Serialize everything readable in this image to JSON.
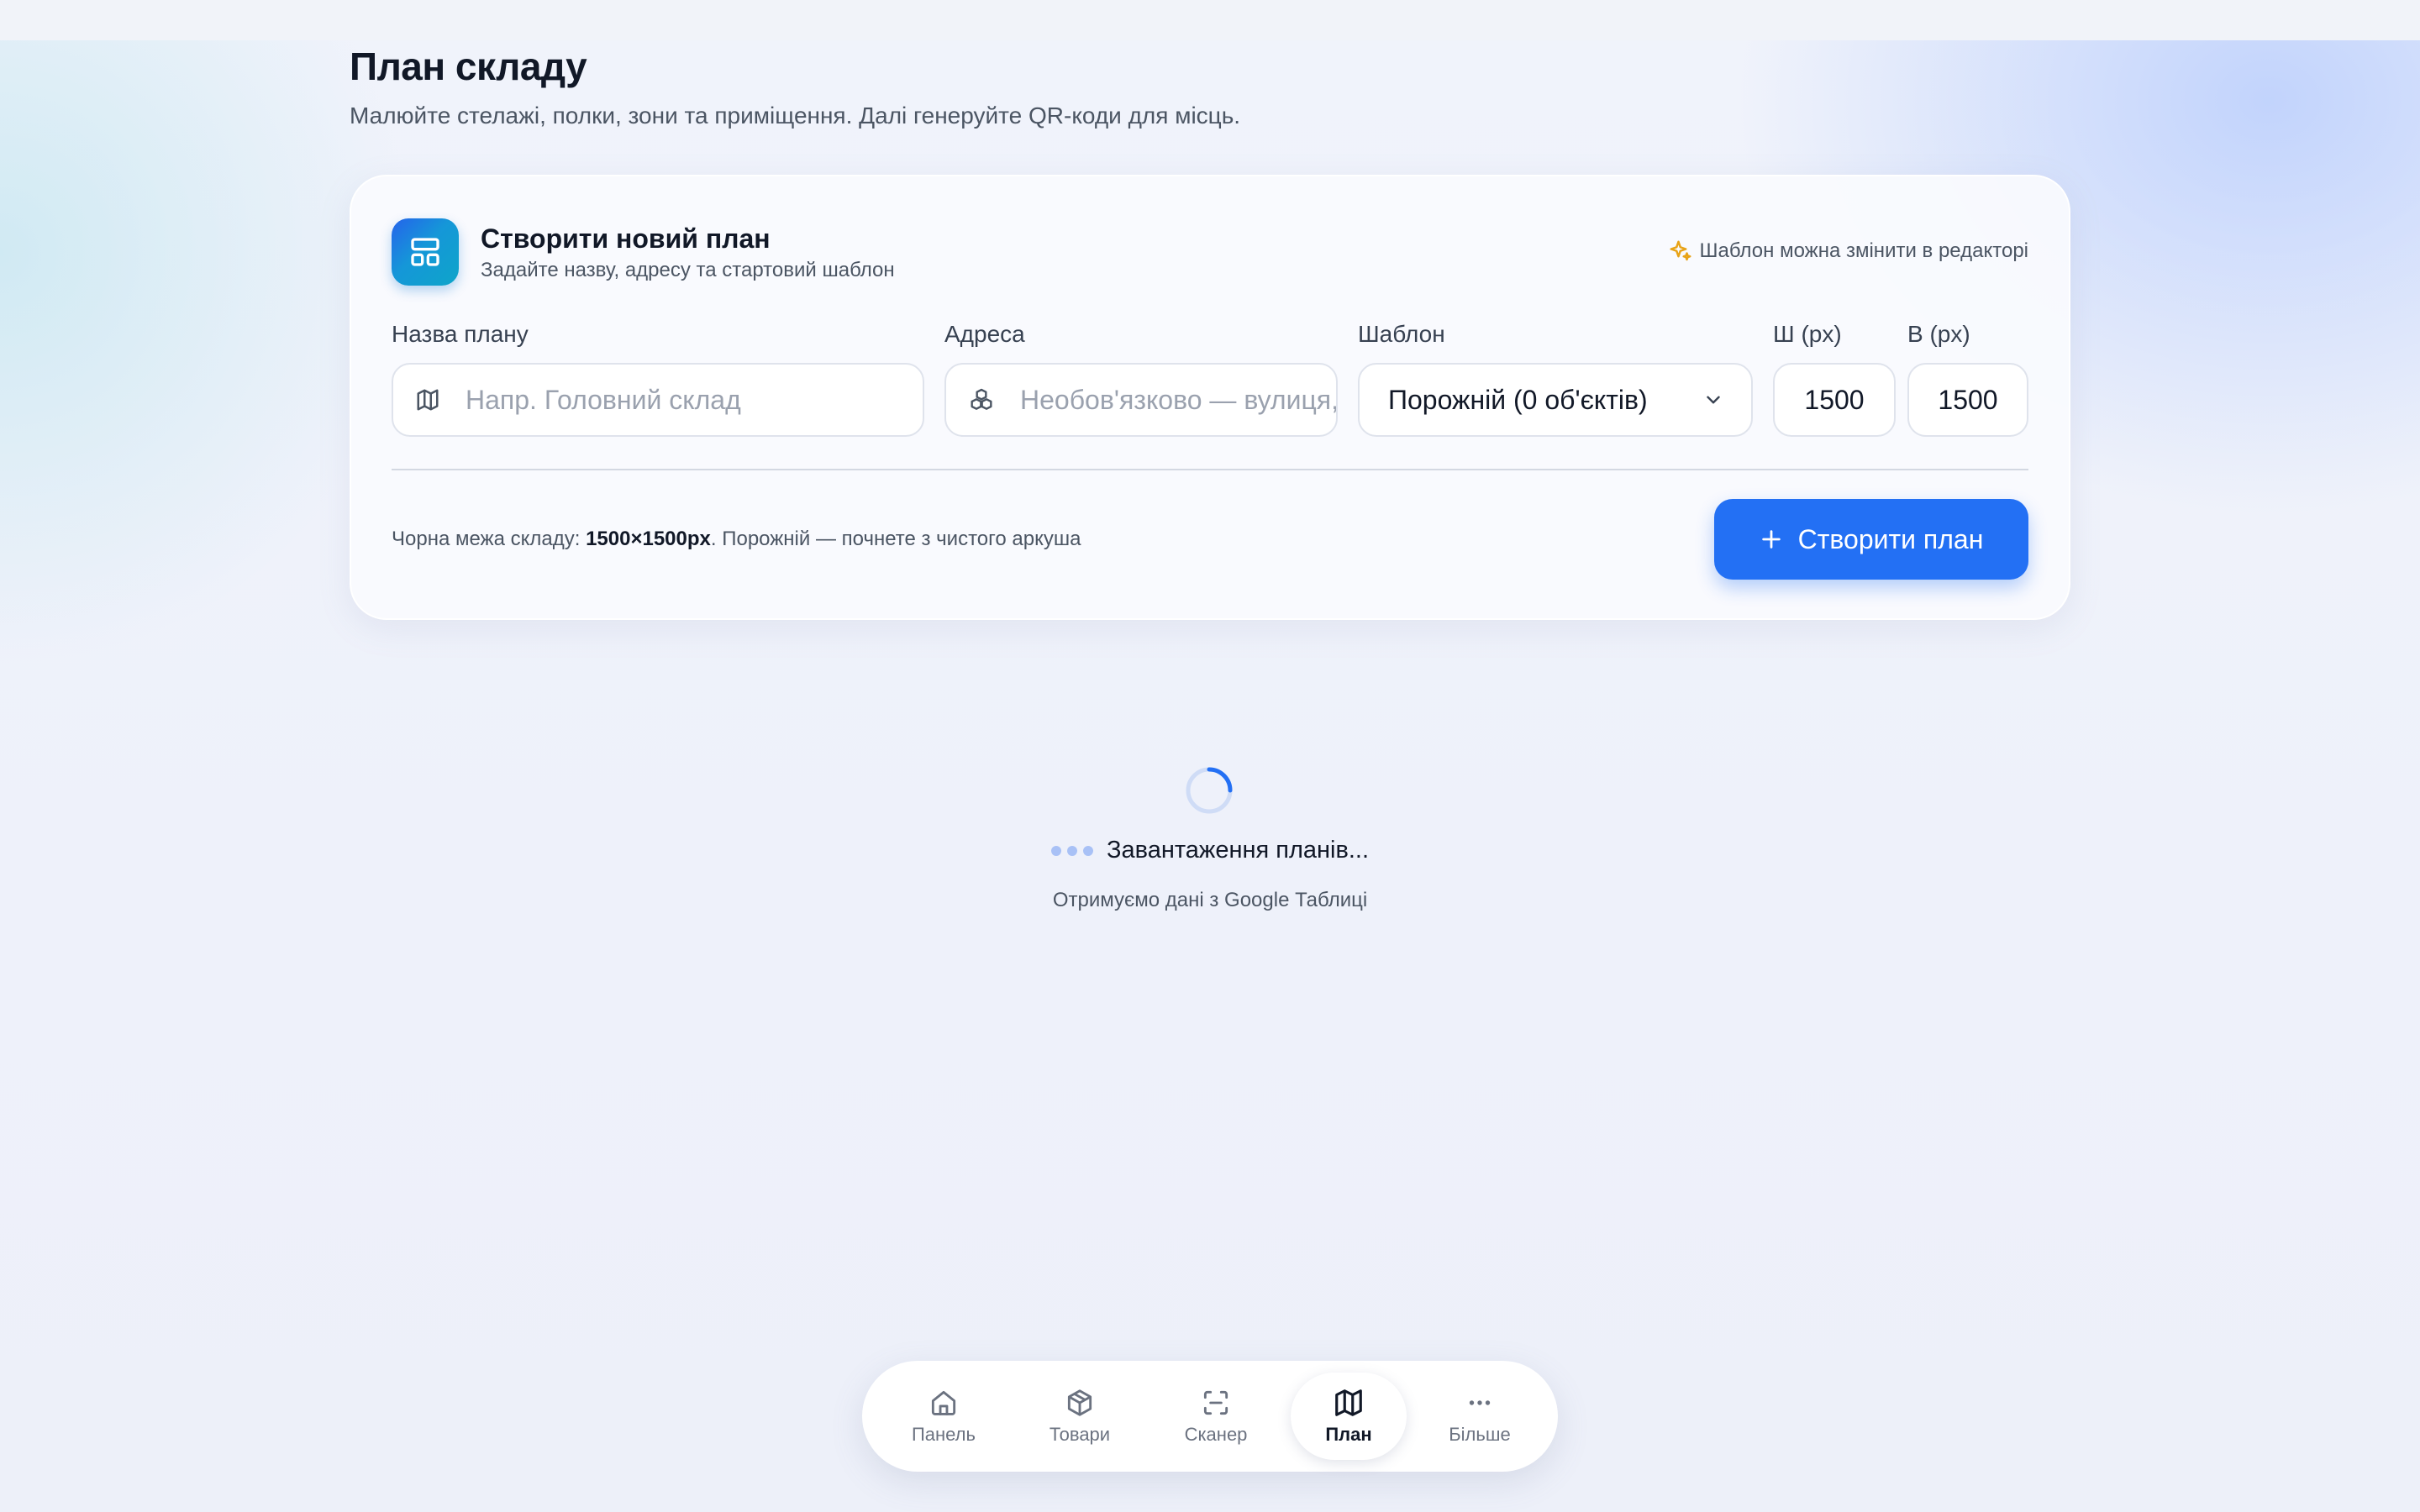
{
  "page": {
    "title": "План складу",
    "subtitle": "Малюйте стелажі, полки, зони та приміщення. Далі генеруйте QR-коди для місць."
  },
  "create_card": {
    "title": "Створити новий план",
    "subtitle": "Задайте назву, адресу та стартовий шаблон",
    "hint": "Шаблон можна змінити в редакторі",
    "fields": {
      "name_label": "Назва плану",
      "name_placeholder": "Напр. Головний склад",
      "name_value": "",
      "address_label": "Адреса",
      "address_placeholder": "Необов'язково — вулиця, місто",
      "address_value": "",
      "template_label": "Шаблон",
      "template_value": "Порожній (0 об'єктів)",
      "width_label": "Ш (px)",
      "width_value": "1500",
      "height_label": "В (px)",
      "height_value": "1500"
    },
    "footnote": {
      "prefix": "Чорна межа складу: ",
      "size": "1500×1500px",
      "suffix": ". Порожній — почнете з чистого аркуша"
    },
    "create_button": "Створити план",
    "accent_color": "#2370f4"
  },
  "loading": {
    "text": "Завантаження планів...",
    "subtext": "Отримуємо дані з Google Таблиці"
  },
  "bottom_nav": {
    "items": [
      {
        "label": "Панель",
        "icon": "home-icon",
        "active": false
      },
      {
        "label": "Товари",
        "icon": "box-icon",
        "active": false
      },
      {
        "label": "Сканер",
        "icon": "scan-icon",
        "active": false
      },
      {
        "label": "План",
        "icon": "map-icon",
        "active": true
      },
      {
        "label": "Більше",
        "icon": "more-icon",
        "active": false
      }
    ]
  }
}
